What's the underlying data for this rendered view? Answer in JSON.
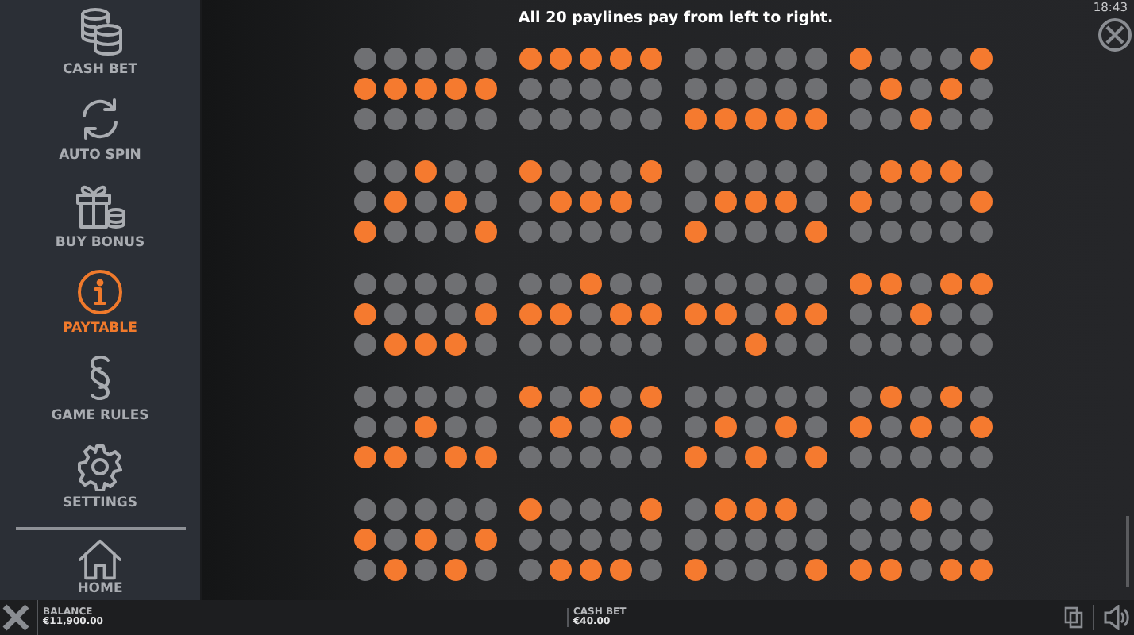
{
  "sidebar": {
    "items": [
      {
        "label": "CASH BET",
        "kind": "coins",
        "selected": false
      },
      {
        "label": "AUTO SPIN",
        "kind": "refresh",
        "selected": false
      },
      {
        "label": "BUY BONUS",
        "kind": "gift",
        "selected": false
      },
      {
        "label": "PAYTABLE",
        "kind": "info",
        "selected": true
      },
      {
        "label": "GAME RULES",
        "kind": "section",
        "selected": false
      },
      {
        "label": "SETTINGS",
        "kind": "gear",
        "selected": false
      }
    ],
    "footer_item": {
      "label": "HOME",
      "kind": "home",
      "selected": false
    }
  },
  "header": {
    "title": "All 20 paylines pay from left to right.",
    "time": "18:43"
  },
  "paylines": [
    {
      "rows": [
        [
          false,
          false,
          false,
          false,
          false
        ],
        [
          true,
          true,
          true,
          true,
          true
        ],
        [
          false,
          false,
          false,
          false,
          false
        ]
      ]
    },
    {
      "rows": [
        [
          true,
          true,
          true,
          true,
          true
        ],
        [
          false,
          false,
          false,
          false,
          false
        ],
        [
          false,
          false,
          false,
          false,
          false
        ]
      ]
    },
    {
      "rows": [
        [
          false,
          false,
          false,
          false,
          false
        ],
        [
          false,
          false,
          false,
          false,
          false
        ],
        [
          true,
          true,
          true,
          true,
          true
        ]
      ]
    },
    {
      "rows": [
        [
          true,
          false,
          false,
          false,
          true
        ],
        [
          false,
          true,
          false,
          true,
          false
        ],
        [
          false,
          false,
          true,
          false,
          false
        ]
      ]
    },
    {
      "rows": [
        [
          false,
          false,
          true,
          false,
          false
        ],
        [
          false,
          true,
          false,
          true,
          false
        ],
        [
          true,
          false,
          false,
          false,
          true
        ]
      ]
    },
    {
      "rows": [
        [
          true,
          false,
          false,
          false,
          true
        ],
        [
          false,
          true,
          true,
          true,
          false
        ],
        [
          false,
          false,
          false,
          false,
          false
        ]
      ]
    },
    {
      "rows": [
        [
          false,
          false,
          false,
          false,
          false
        ],
        [
          false,
          true,
          true,
          true,
          false
        ],
        [
          true,
          false,
          false,
          false,
          true
        ]
      ]
    },
    {
      "rows": [
        [
          false,
          true,
          true,
          true,
          false
        ],
        [
          true,
          false,
          false,
          false,
          true
        ],
        [
          false,
          false,
          false,
          false,
          false
        ]
      ]
    },
    {
      "rows": [
        [
          false,
          false,
          false,
          false,
          false
        ],
        [
          true,
          false,
          false,
          false,
          true
        ],
        [
          false,
          true,
          true,
          true,
          false
        ]
      ]
    },
    {
      "rows": [
        [
          false,
          false,
          true,
          false,
          false
        ],
        [
          true,
          true,
          false,
          true,
          true
        ],
        [
          false,
          false,
          false,
          false,
          false
        ]
      ]
    },
    {
      "rows": [
        [
          false,
          false,
          false,
          false,
          false
        ],
        [
          true,
          true,
          false,
          true,
          true
        ],
        [
          false,
          false,
          true,
          false,
          false
        ]
      ]
    },
    {
      "rows": [
        [
          true,
          true,
          false,
          true,
          true
        ],
        [
          false,
          false,
          true,
          false,
          false
        ],
        [
          false,
          false,
          false,
          false,
          false
        ]
      ]
    },
    {
      "rows": [
        [
          false,
          false,
          false,
          false,
          false
        ],
        [
          false,
          false,
          true,
          false,
          false
        ],
        [
          true,
          true,
          false,
          true,
          true
        ]
      ]
    },
    {
      "rows": [
        [
          true,
          false,
          true,
          false,
          true
        ],
        [
          false,
          true,
          false,
          true,
          false
        ],
        [
          false,
          false,
          false,
          false,
          false
        ]
      ]
    },
    {
      "rows": [
        [
          false,
          false,
          false,
          false,
          false
        ],
        [
          false,
          true,
          false,
          true,
          false
        ],
        [
          true,
          false,
          true,
          false,
          true
        ]
      ]
    },
    {
      "rows": [
        [
          false,
          true,
          false,
          true,
          false
        ],
        [
          true,
          false,
          true,
          false,
          true
        ],
        [
          false,
          false,
          false,
          false,
          false
        ]
      ]
    },
    {
      "rows": [
        [
          false,
          false,
          false,
          false,
          false
        ],
        [
          true,
          false,
          true,
          false,
          true
        ],
        [
          false,
          true,
          false,
          true,
          false
        ]
      ]
    },
    {
      "rows": [
        [
          true,
          false,
          false,
          false,
          true
        ],
        [
          false,
          false,
          false,
          false,
          false
        ],
        [
          false,
          true,
          true,
          true,
          false
        ]
      ]
    },
    {
      "rows": [
        [
          false,
          true,
          true,
          true,
          false
        ],
        [
          false,
          false,
          false,
          false,
          false
        ],
        [
          true,
          false,
          false,
          false,
          true
        ]
      ]
    },
    {
      "rows": [
        [
          false,
          false,
          true,
          false,
          false
        ],
        [
          false,
          false,
          false,
          false,
          false
        ],
        [
          true,
          true,
          false,
          true,
          true
        ]
      ]
    }
  ],
  "bottom_bar": {
    "balance_label": "BALANCE",
    "balance": "€11,900.00",
    "bet_label": "CASH BET",
    "bet": "€40.00"
  }
}
